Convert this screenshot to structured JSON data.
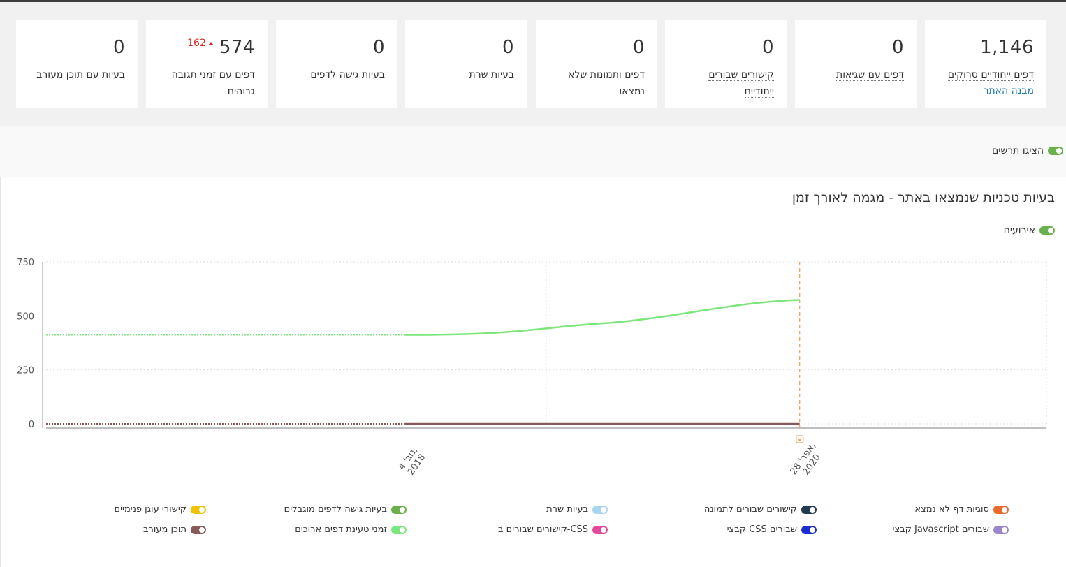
{
  "stats": [
    {
      "value": "1,146",
      "label": "דפים ייחודיים סרוקים",
      "link": "מבנה האתר"
    },
    {
      "value": "0",
      "label": "דפים עם שגיאות"
    },
    {
      "value": "0",
      "label": "קישורים שבורים ייחודיים"
    },
    {
      "value": "0",
      "label": "דפים ותמונות שלא נמצאו"
    },
    {
      "value": "0",
      "label": "בעיות שרת"
    },
    {
      "value": "0",
      "label": "בעיות גישה לדפים"
    },
    {
      "value": "574",
      "delta": "162",
      "label": "דפים עם זמני תגובה גבוהים"
    },
    {
      "value": "0",
      "label": "בעיות עם תוכן מעורב"
    }
  ],
  "show_charts": {
    "label": "הציגו תרשים",
    "on": true,
    "color": "#6ab04c"
  },
  "chart_panel": {
    "title": "בעיות טכניות שנמצאו באתר - מגמה לאורך זמן",
    "events_toggle": {
      "label": "אירועים",
      "on": true,
      "color": "#6ab04c"
    }
  },
  "chart_data": {
    "type": "line",
    "x_tick_labels": [
      "נוב' 4, 2018",
      "אפר' 28, 2020"
    ],
    "x_range": [
      "2017-07-01",
      "2021-04-01"
    ],
    "ylim": [
      0,
      750
    ],
    "y_ticks": [
      0,
      250,
      500,
      750
    ],
    "grid": true,
    "event_marker_date": "2020-04-28",
    "series": [
      {
        "name": "זמני טעינת דפים ארוכים",
        "color": "#7be67b",
        "x": [
          "2018-11-04",
          "2019-08-01",
          "2020-04-28"
        ],
        "values": [
          412,
          465,
          574
        ],
        "before_value": 412
      },
      {
        "name": "תוכן מעורב",
        "color": "#8a5a5a",
        "x": [
          "2018-11-04",
          "2020-04-28"
        ],
        "values": [
          0,
          0
        ],
        "before_value": 0
      }
    ]
  },
  "legend": [
    {
      "label": "סוגיות דף לא נמצא",
      "color": "#e8692a"
    },
    {
      "label": "קישורים שבורים לתמונה",
      "color": "#1f3b4d"
    },
    {
      "label": "בעיות שרת",
      "color": "#a8d5f0"
    },
    {
      "label": "בעיות גישה לדפים מוגבלים",
      "color": "#6ab04c"
    },
    {
      "label": "קישורי עוגן פנימיים",
      "color": "#f2c200"
    },
    {
      "label": "שבורים Javascript קבצי",
      "color": "#9b86c9"
    },
    {
      "label": "שבורים CSS קבצי",
      "color": "#1b2fd1"
    },
    {
      "label": "CSS-קישורים שבורים ב",
      "color": "#e8489a"
    },
    {
      "label": "זמני טעינת דפים ארוכים",
      "color": "#7be67b"
    },
    {
      "label": "תוכן מעורב",
      "color": "#8a5a5a"
    }
  ]
}
